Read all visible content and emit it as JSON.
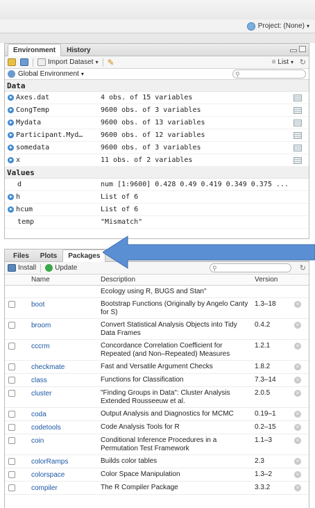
{
  "project": {
    "label": "Project: (None)"
  },
  "env_pane": {
    "tabs": [
      "Environment",
      "History"
    ],
    "toolbar": {
      "import_label": "Import Dataset",
      "list_label": "List"
    },
    "scope_label": "Global Environment",
    "sections": {
      "data": "Data",
      "values": "Values"
    },
    "data_rows": [
      {
        "name": "Axes.dat",
        "value": "4 obs. of 15 variables"
      },
      {
        "name": "CongTemp",
        "value": "9600 obs. of 3 variables"
      },
      {
        "name": "Mydata",
        "value": "9600 obs. of 13 variables"
      },
      {
        "name": "Participant.Myd…",
        "value": "9600 obs. of 12 variables"
      },
      {
        "name": "somedata",
        "value": "9600 obs. of 3 variables"
      },
      {
        "name": "x",
        "value": "11 obs. of 2 variables"
      }
    ],
    "value_rows": [
      {
        "name": "d",
        "value": "num [1:9600] 0.428 0.49 0.419 0.349 0.375 ..."
      },
      {
        "name": "h",
        "value": "List of 6"
      },
      {
        "name": "hcum",
        "value": "List of 6"
      },
      {
        "name": "temp",
        "value": "\"Mismatch\""
      }
    ]
  },
  "pkg_pane": {
    "tabs": [
      "Files",
      "Plots",
      "Packages"
    ],
    "toolbar": {
      "install_label": "Install",
      "update_label": "Update"
    },
    "columns": {
      "name": "Name",
      "description": "Description",
      "version": "Version"
    },
    "partial_row": "Ecology using R, BUGS and Stan\"",
    "rows": [
      {
        "name": "boot",
        "desc": "Bootstrap Functions (Originally by Angelo Canty for S)",
        "version": "1.3–18"
      },
      {
        "name": "broom",
        "desc": "Convert Statistical Analysis Objects into Tidy Data Frames",
        "version": "0.4.2"
      },
      {
        "name": "cccrm",
        "desc": "Concordance Correlation Coefficient for Repeated (and Non–Repeated) Measures",
        "version": "1.2.1"
      },
      {
        "name": "checkmate",
        "desc": "Fast and Versatile Argument Checks",
        "version": "1.8.2"
      },
      {
        "name": "class",
        "desc": "Functions for Classification",
        "version": "7.3–14"
      },
      {
        "name": "cluster",
        "desc": "\"Finding Groups in Data\": Cluster Analysis Extended Rousseeuw et al.",
        "version": "2.0.5"
      },
      {
        "name": "coda",
        "desc": "Output Analysis and Diagnostics for MCMC",
        "version": "0.19–1"
      },
      {
        "name": "codetools",
        "desc": "Code Analysis Tools for R",
        "version": "0.2–15"
      },
      {
        "name": "coin",
        "desc": "Conditional Inference Procedures in a Permutation Test Framework",
        "version": "1.1–3"
      },
      {
        "name": "colorRamps",
        "desc": "Builds color tables",
        "version": "2.3"
      },
      {
        "name": "colorspace",
        "desc": "Color Space Manipulation",
        "version": "1.3–2"
      },
      {
        "name": "compiler",
        "desc": "The R Compiler Package",
        "version": "3.3.2"
      }
    ]
  },
  "colors": {
    "link": "#1a57a6",
    "arrow": "#5b8fd4",
    "info_dot": "#3f8ad3",
    "update_green": "#3aa845"
  }
}
